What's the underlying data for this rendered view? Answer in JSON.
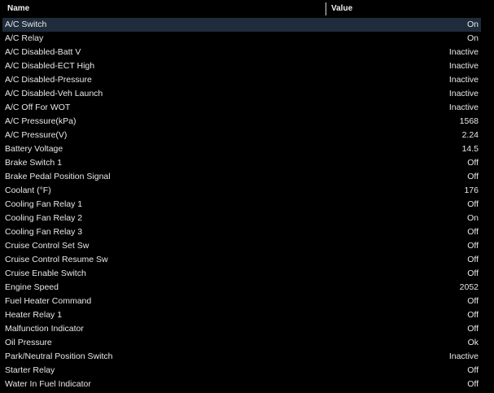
{
  "header": {
    "name_label": "Name",
    "value_label": "Value"
  },
  "rows": [
    {
      "name": "A/C Switch",
      "value": "On",
      "selected": true
    },
    {
      "name": "A/C Relay",
      "value": "On"
    },
    {
      "name": "A/C Disabled-Batt V",
      "value": "Inactive"
    },
    {
      "name": "A/C Disabled-ECT High",
      "value": "Inactive"
    },
    {
      "name": "A/C Disabled-Pressure",
      "value": "Inactive"
    },
    {
      "name": "A/C Disabled-Veh Launch",
      "value": "Inactive"
    },
    {
      "name": "A/C Off For WOT",
      "value": "Inactive"
    },
    {
      "name": "A/C Pressure(kPa)",
      "value": "1568"
    },
    {
      "name": "A/C Pressure(V)",
      "value": "2.24"
    },
    {
      "name": "Battery Voltage",
      "value": "14.5"
    },
    {
      "name": "Brake Switch 1",
      "value": "Off"
    },
    {
      "name": "Brake Pedal Position Signal",
      "value": "Off"
    },
    {
      "name": "Coolant (°F)",
      "value": "176"
    },
    {
      "name": "Cooling Fan Relay 1",
      "value": "Off"
    },
    {
      "name": "Cooling Fan Relay 2",
      "value": "On"
    },
    {
      "name": "Cooling Fan Relay 3",
      "value": "Off"
    },
    {
      "name": "Cruise Control Set Sw",
      "value": "Off"
    },
    {
      "name": "Cruise Control Resume Sw",
      "value": "Off"
    },
    {
      "name": "Cruise Enable Switch",
      "value": "Off"
    },
    {
      "name": "Engine Speed",
      "value": "2052"
    },
    {
      "name": "Fuel Heater Command",
      "value": "Off"
    },
    {
      "name": "Heater Relay 1",
      "value": "Off"
    },
    {
      "name": "Malfunction Indicator",
      "value": "Off"
    },
    {
      "name": "Oil Pressure",
      "value": "Ok"
    },
    {
      "name": "Park/Neutral Position Switch",
      "value": "Inactive"
    },
    {
      "name": "Starter Relay",
      "value": "Off"
    },
    {
      "name": "Water In Fuel Indicator",
      "value": "Off"
    }
  ],
  "colors": {
    "background": "#000000",
    "text": "#e8e8e8",
    "selected_row": "#1f2c3b"
  }
}
